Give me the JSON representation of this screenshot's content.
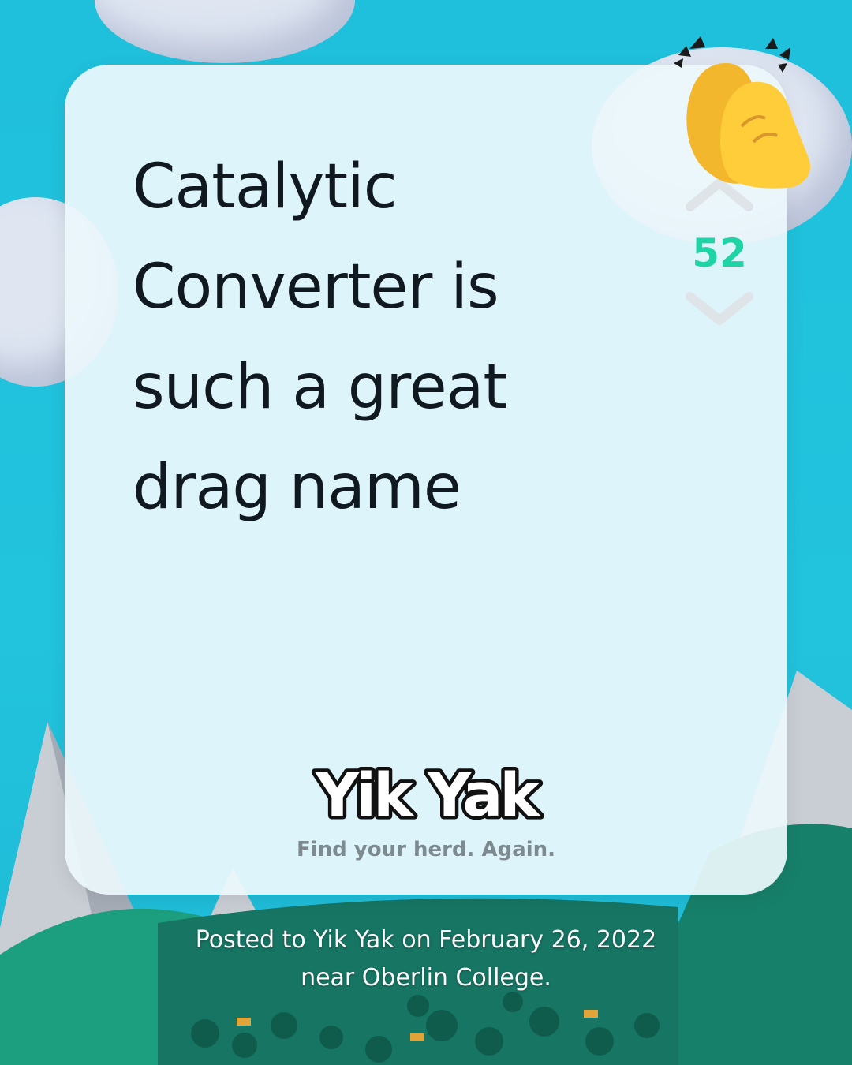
{
  "post": {
    "text": "Catalytic Converter is such a great drag name"
  },
  "votes": {
    "score": "52",
    "accent_color": "#1ed3a6",
    "upvote_icon": "chevron-up-icon",
    "downvote_icon": "chevron-down-icon"
  },
  "reaction": {
    "icon": "clapping-hands-icon"
  },
  "brand": {
    "logo_text": "Yik Yak",
    "tagline": "Find your herd. Again."
  },
  "caption": "Posted to Yik Yak on February 26, 2022 near Oberlin College."
}
